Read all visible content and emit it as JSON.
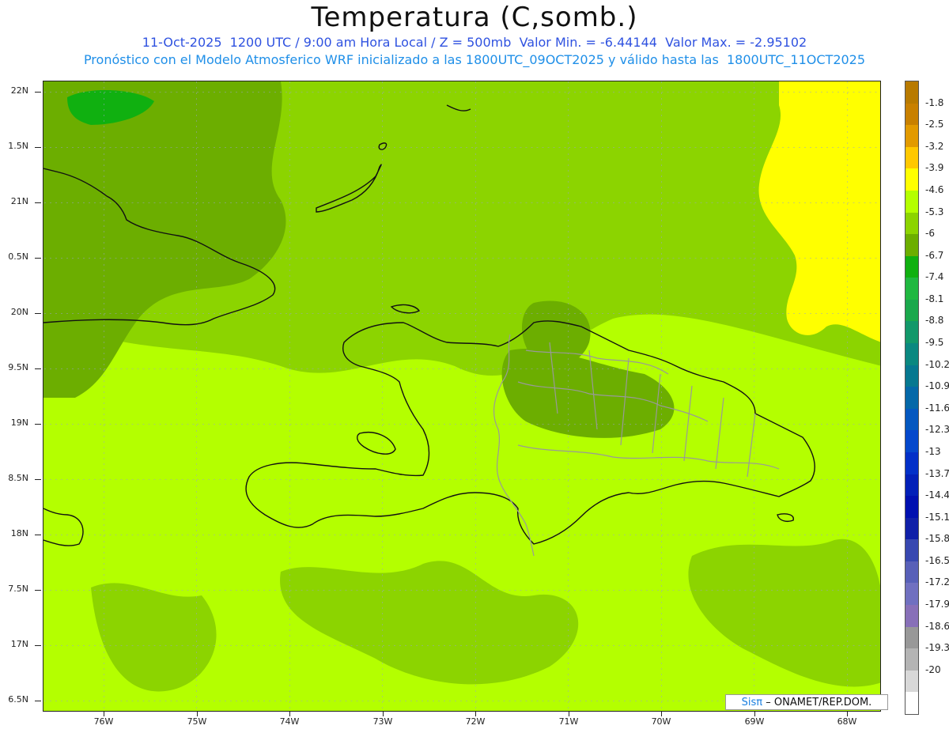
{
  "header": {
    "title": "Temperatura (C,somb.)",
    "line1": "11-Oct-2025  1200 UTC / 9:00 am Hora Local / Z = 500mb  Valor Min. = -6.44144  Valor Max. = -2.95102",
    "line2": "Pronóstico con el Modelo Atmosferico WRF inicializado a las 1800UTC_09OCT2025 y válido hasta las  1800UTC_11OCT2025"
  },
  "axes": {
    "lat_labels": [
      "22N",
      "1.5N",
      "21N",
      "0.5N",
      "20N",
      "9.5N",
      "19N",
      "8.5N",
      "18N",
      "7.5N",
      "17N",
      "6.5N"
    ],
    "lon_labels": [
      "76W",
      "75W",
      "74W",
      "73W",
      "72W",
      "71W",
      "70W",
      "69W",
      "68W"
    ]
  },
  "colorbar": {
    "labels": [
      "-1.8",
      "-2.5",
      "-3.2",
      "-3.9",
      "-4.6",
      "-5.3",
      "-6",
      "-6.7",
      "-7.4",
      "-8.1",
      "-8.8",
      "-9.5",
      "-10.2",
      "-10.9",
      "-11.6",
      "-12.3",
      "-13",
      "-13.7",
      "-14.4",
      "-15.1",
      "-15.8",
      "-16.5",
      "-17.2",
      "-17.9",
      "-18.6",
      "-19.3",
      "-20"
    ],
    "colors": [
      "#c88000",
      "#e29a00",
      "#ffc800",
      "#ffff00",
      "#b4ff00",
      "#8cd400",
      "#6cae00",
      "#10b010",
      "#20b840",
      "#1aa84c",
      "#12986a",
      "#0a8880",
      "#067890",
      "#0468a8",
      "#0458c0",
      "#0448cc",
      "#0230c8",
      "#0220b8",
      "#0010b0",
      "#1020a8",
      "#3848b0",
      "#5860b8",
      "#7070c0",
      "#8870b8",
      "#989898",
      "#b4b4b4",
      "#d8d8d8"
    ],
    "top_color": "#b87a00",
    "bottom_color": "#ffffff"
  },
  "credit": {
    "brand": "Sisπ",
    "text": "– ONAMET/REP.DOM."
  }
}
